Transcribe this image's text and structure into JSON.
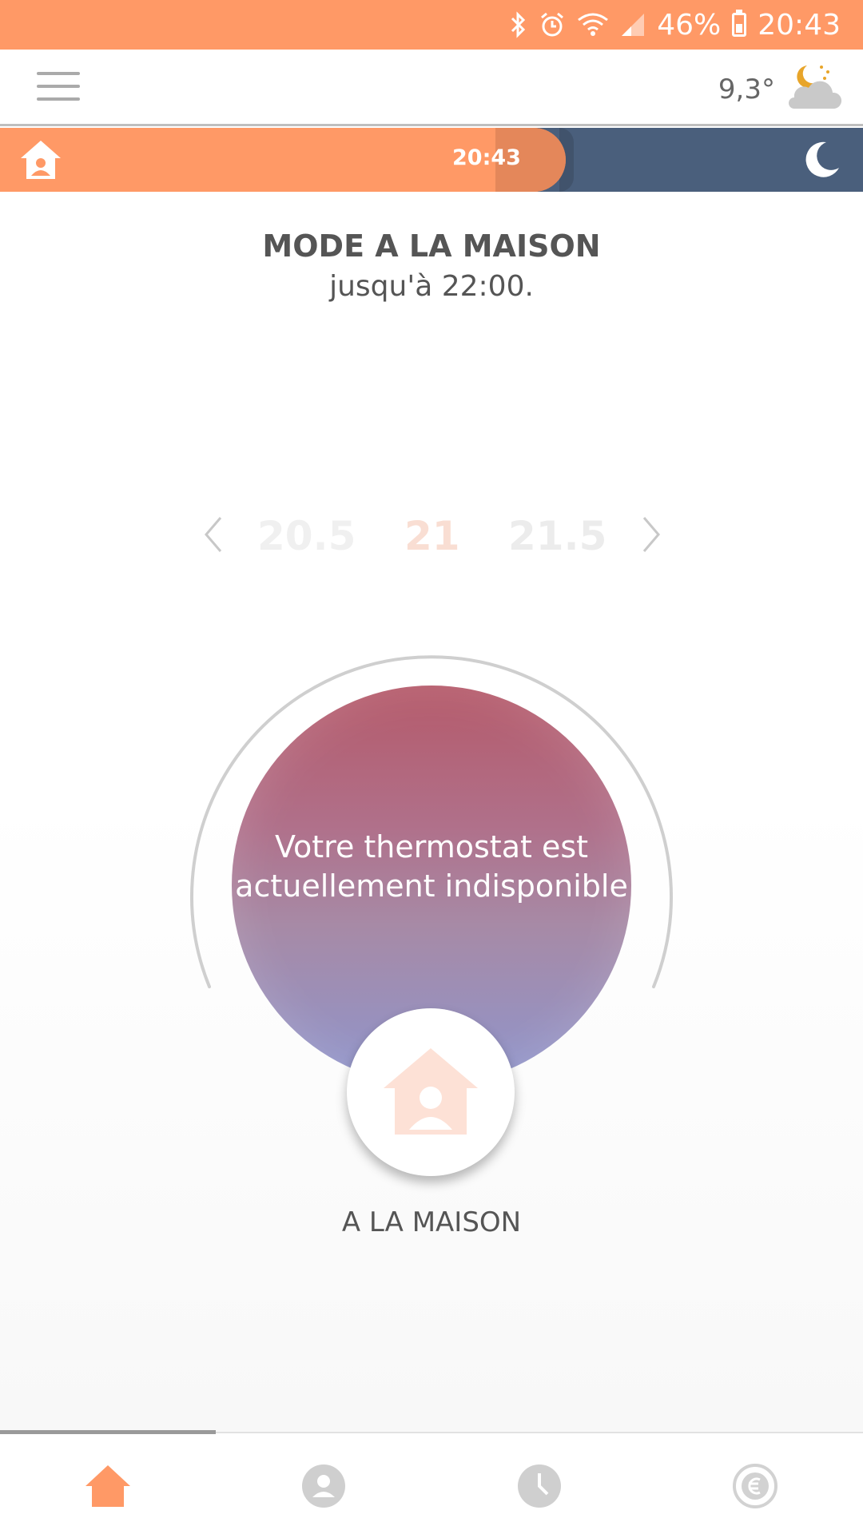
{
  "status_bar": {
    "battery_percent": "46%",
    "time": "20:43",
    "icons": [
      "bluetooth-icon",
      "alarm-icon",
      "wifi-icon",
      "signal-icon",
      "battery-icon"
    ]
  },
  "header": {
    "menu_icon": "hamburger-icon",
    "outdoor_temp": "9,3°",
    "weather_icon": "night-cloud-icon"
  },
  "schedule_strip": {
    "current_time": "20:43",
    "start_icon": "home-person-icon",
    "end_icon": "moon-icon"
  },
  "mode": {
    "title": "MODE A LA MAISON",
    "subtitle": "jusqu'à 22:00."
  },
  "temperature_picker": {
    "previous": "20.5",
    "current": "21",
    "next": "21.5"
  },
  "dial": {
    "message": "Votre thermostat est actuellement indisponible",
    "mode_label": "A LA MAISON"
  },
  "bottom_nav": {
    "items": [
      "home",
      "profile",
      "schedule",
      "consumption"
    ],
    "active": "home"
  },
  "colors": {
    "accent": "#ff9966",
    "night": "#4a5f7c",
    "disc_top": "#b55a6a",
    "disc_bottom": "#8f95cc"
  }
}
